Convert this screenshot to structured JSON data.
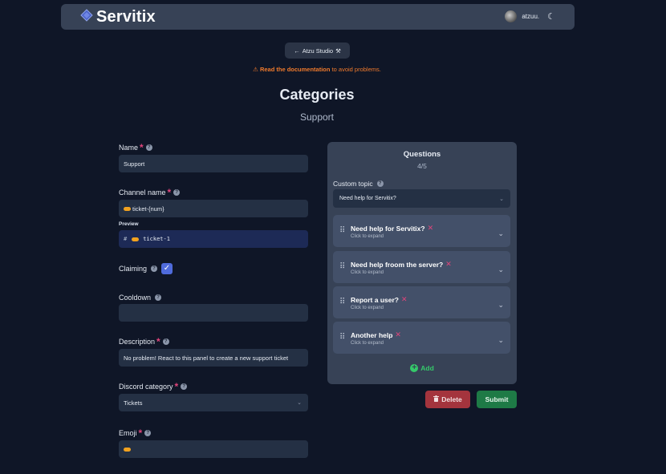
{
  "navbar": {
    "brand": "Servitix",
    "username": "atzuu.",
    "logo_icon": "diamond-logo-icon",
    "theme_icon": "moon-icon"
  },
  "back_button": {
    "label": "Atzu Studio",
    "icon": "arrow-left-icon",
    "emoji": "⚒"
  },
  "warning": {
    "icon": "⚠",
    "link": "Read the documentation",
    "rest": " to avoid problems."
  },
  "page": {
    "title": "Categories",
    "subtitle": "Support"
  },
  "form": {
    "name": {
      "label": "Name",
      "value": "Support"
    },
    "channel_name": {
      "label": "Channel name",
      "value": "ticket-{num}"
    },
    "preview": {
      "label": "Preview",
      "hash": "#",
      "value": "ticket-1"
    },
    "claiming": {
      "label": "Claiming",
      "checked": true
    },
    "cooldown": {
      "label": "Cooldown",
      "value": ""
    },
    "description": {
      "label": "Description",
      "value": "No problem! React to this panel to create a new support ticket"
    },
    "discord_category": {
      "label": "Discord category",
      "value": "Tickets"
    },
    "emoji": {
      "label": "Emoji"
    }
  },
  "questions": {
    "title": "Questions",
    "count": "4/5",
    "custom_topic_label": "Custom topic",
    "custom_topic_value": "Need help for Servitix?",
    "items": [
      {
        "title": "Need help for Servitix?",
        "hint": "Click to expand"
      },
      {
        "title": "Need help froom the server?",
        "hint": "Click to expand"
      },
      {
        "title": "Report a user?",
        "hint": "Click to expand"
      },
      {
        "title": "Another help",
        "hint": "Click to expand"
      }
    ],
    "add_label": "Add"
  },
  "actions": {
    "delete_label": "Delete",
    "submit_label": "Submit"
  },
  "colors": {
    "background": "#0f1627",
    "panel": "#374256",
    "required": "#e0457b",
    "warning": "#f07a2c",
    "add": "#35c96a",
    "delete": "#a4343d",
    "submit": "#1e7a46",
    "checkbox": "#4f6bdc"
  }
}
